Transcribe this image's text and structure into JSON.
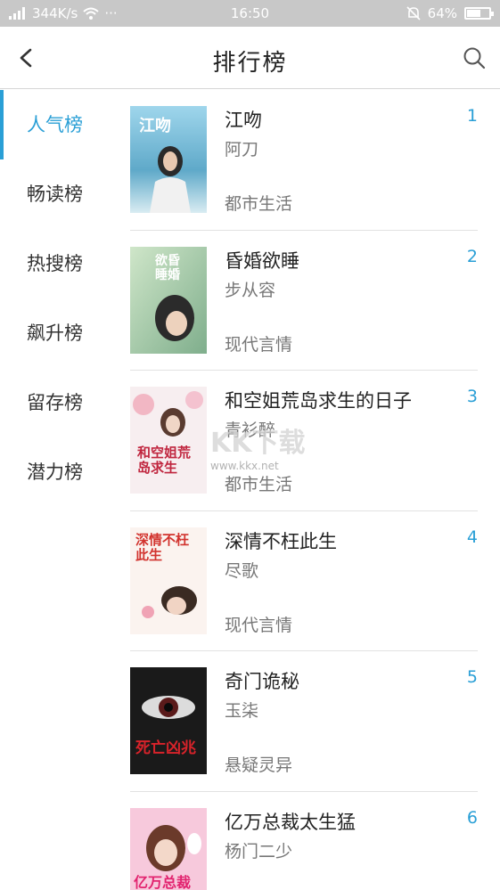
{
  "status_bar": {
    "network_speed": "344K/s",
    "time": "16:50",
    "battery_percent": "64%",
    "battery_level": 0.64
  },
  "header": {
    "title": "排行榜"
  },
  "sidebar": {
    "items": [
      {
        "label": "人气榜",
        "active": true
      },
      {
        "label": "畅读榜",
        "active": false
      },
      {
        "label": "热搜榜",
        "active": false
      },
      {
        "label": "飙升榜",
        "active": false
      },
      {
        "label": "留存榜",
        "active": false
      },
      {
        "label": "潜力榜",
        "active": false
      }
    ]
  },
  "books": [
    {
      "rank": "1",
      "title": "江吻",
      "author": "阿刀",
      "genre": "都市生活",
      "cover_text": "江吻"
    },
    {
      "rank": "2",
      "title": "昏婚欲睡",
      "author": "步从容",
      "genre": "现代言情",
      "cover_text": "欲昏睡婚"
    },
    {
      "rank": "3",
      "title": "和空姐荒岛求生的日子",
      "author": "青衫醉",
      "genre": "都市生活",
      "cover_text": "和空姐荒岛求生"
    },
    {
      "rank": "4",
      "title": "深情不枉此生",
      "author": "尽歌",
      "genre": "现代言情",
      "cover_text": "深情不枉此生"
    },
    {
      "rank": "5",
      "title": "奇门诡秘",
      "author": "玉柒",
      "genre": "悬疑灵异",
      "cover_text": "死亡凶兆"
    },
    {
      "rank": "6",
      "title": "亿万总裁太生猛",
      "author": "杨门二少",
      "genre": "",
      "cover_text": "亿万总裁"
    }
  ],
  "watermark": {
    "logo": "KK下载",
    "url": "www.kkx.net"
  },
  "colors": {
    "accent": "#2a9fd6",
    "status_bar": "#c8c8c8"
  }
}
